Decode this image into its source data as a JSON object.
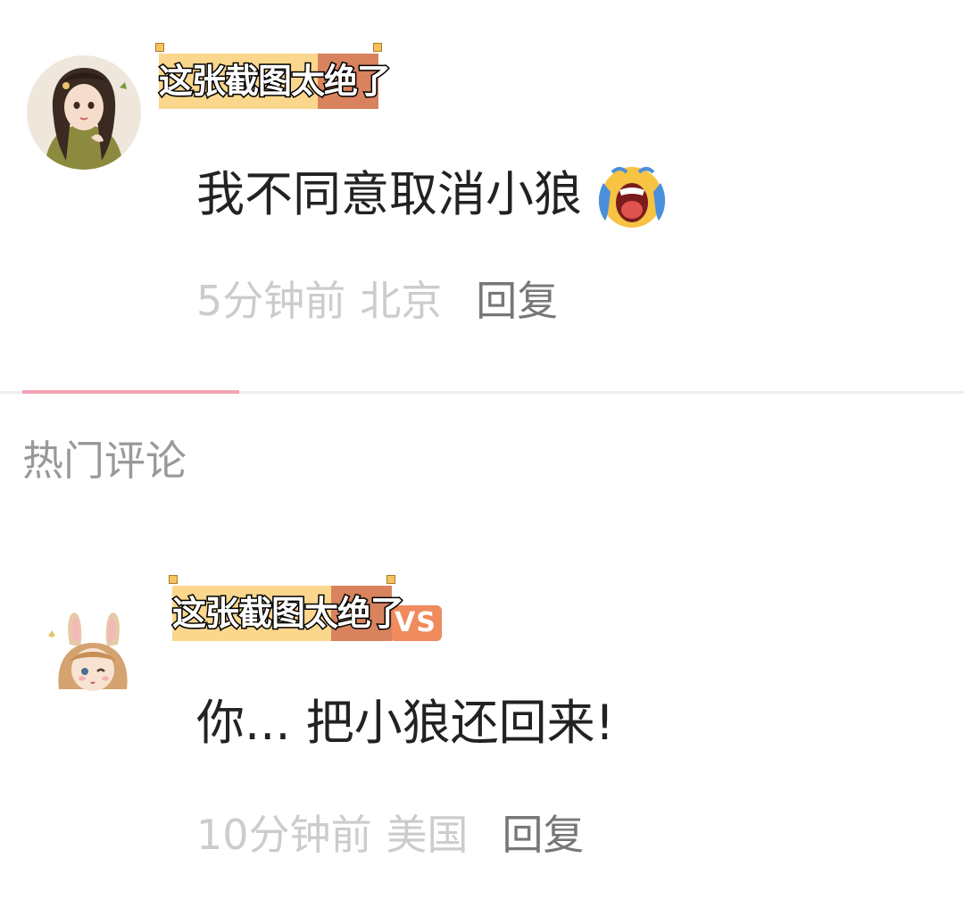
{
  "overlay_caption": "这张截图太绝了",
  "comments": [
    {
      "text": "我不同意取消小狼",
      "emoji": "crying-emoji",
      "time": "5分钟前",
      "location": "北京",
      "reply_label": "回复"
    },
    {
      "badge": "VS",
      "text": "你... 把小狼还回来!",
      "time": "10分钟前",
      "location": "美国",
      "reply_label": "回复"
    }
  ],
  "section": {
    "title": "热门评论"
  },
  "colors": {
    "accent_pink": "#f4a3b4",
    "sticker_yellow": "#fbd78d",
    "sticker_orange": "#d9835e",
    "badge_orange": "#ef8b5c"
  }
}
